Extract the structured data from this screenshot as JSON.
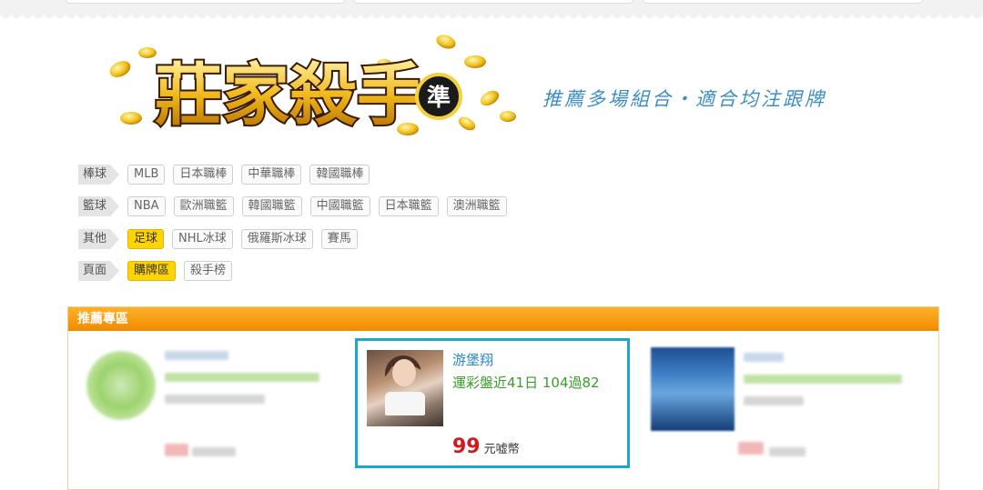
{
  "header": {
    "logo_text": "莊家殺手",
    "logo_badge": "準",
    "slogan": "推薦多場組合・適合均注跟牌"
  },
  "nav_rows": [
    {
      "category": "棒球",
      "items": [
        {
          "label": "MLB",
          "active": false
        },
        {
          "label": "日本職棒",
          "active": false
        },
        {
          "label": "中華職棒",
          "active": false
        },
        {
          "label": "韓國職棒",
          "active": false
        }
      ]
    },
    {
      "category": "籃球",
      "items": [
        {
          "label": "NBA",
          "active": false
        },
        {
          "label": "歐洲職籃",
          "active": false
        },
        {
          "label": "韓國職籃",
          "active": false
        },
        {
          "label": "中國職籃",
          "active": false
        },
        {
          "label": "日本職籃",
          "active": false
        },
        {
          "label": "澳洲職籃",
          "active": false
        }
      ]
    },
    {
      "category": "其他",
      "items": [
        {
          "label": "足球",
          "active": true
        },
        {
          "label": "NHL冰球",
          "active": false
        },
        {
          "label": "俄羅斯冰球",
          "active": false
        },
        {
          "label": "賽馬",
          "active": false
        }
      ]
    },
    {
      "category": "頁面",
      "items": [
        {
          "label": "購牌區",
          "active": true
        },
        {
          "label": "殺手榜",
          "active": false
        }
      ]
    }
  ],
  "recommend": {
    "title": "推薦專區",
    "featured": {
      "name": "游堡翔",
      "record": "運彩盤近41日 104過82",
      "price": "99",
      "unit": "元嘘幣"
    }
  },
  "colors": {
    "accent_orange": "#f08a00",
    "highlight_yellow": "#ffd400",
    "featured_border": "#1aa7c9",
    "price_red": "#d0191e",
    "name_blue": "#2a86c8",
    "record_green": "#3a9b2a"
  }
}
